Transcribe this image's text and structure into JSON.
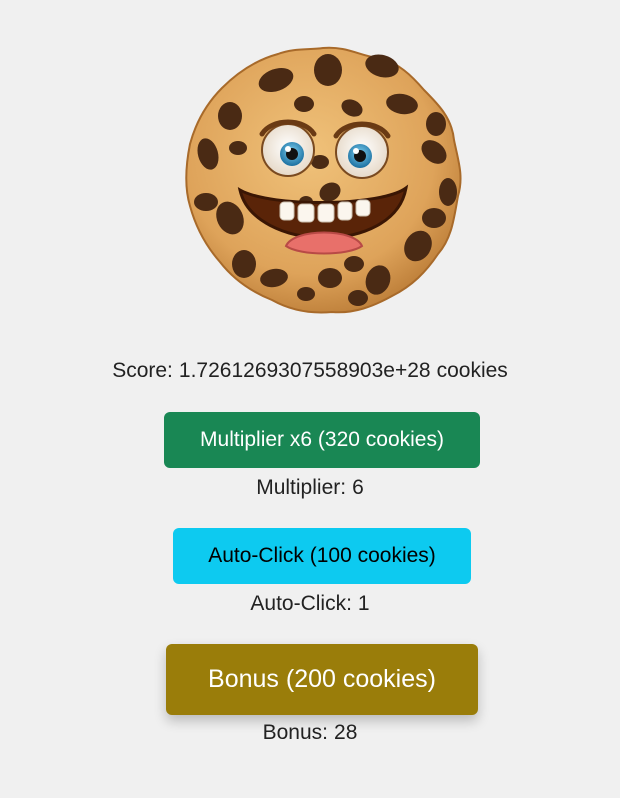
{
  "game": {
    "cookie_icon": "smiling-cookie-icon",
    "score": {
      "prefix": "Score:",
      "value": "1.7261269307558903e+28",
      "unit": "cookies"
    },
    "buttons": {
      "multiplier": "Multiplier x6 (320 cookies)",
      "autoclick": "Auto-Click (100 cookies)",
      "bonus": "Bonus (200 cookies)"
    },
    "stats": {
      "multiplier_label": "Multiplier:",
      "multiplier_value": "6",
      "autoclick_label": "Auto-Click:",
      "autoclick_value": "1",
      "bonus_label": "Bonus:",
      "bonus_value": "28"
    },
    "colors": {
      "background": "#f0f0f0",
      "multiplier_button": "#198754",
      "autoclick_button": "#0dcaf0",
      "bonus_button": "#9a7d0a"
    }
  }
}
